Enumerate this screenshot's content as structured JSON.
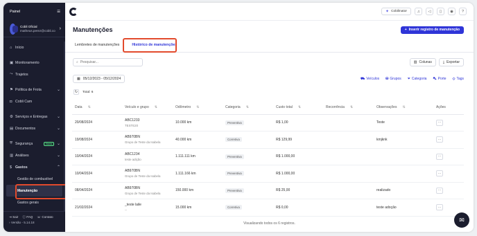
{
  "sidebar": {
    "title": "Painel",
    "user_name": "Cobli Oficial",
    "user_email": "matheus.perez@cobli.co",
    "items": [
      {
        "label": "Início",
        "icon": "home-icon",
        "arrow": ""
      },
      {
        "label": "Monitoramento",
        "icon": "monitor-icon",
        "arrow": ""
      },
      {
        "label": "Trajetos",
        "icon": "route-icon",
        "arrow": ""
      },
      {
        "label": "Política de Frota",
        "icon": "policy-icon",
        "arrow": "⌄"
      },
      {
        "label": "Cobli Cam",
        "icon": "camera-icon",
        "arrow": ""
      },
      {
        "label": "Serviços e Entregas",
        "icon": "services-icon",
        "arrow": "⌄"
      },
      {
        "label": "Documentos",
        "icon": "documents-icon",
        "arrow": "⌄"
      },
      {
        "label": "Segurança",
        "icon": "security-icon",
        "arrow": "⌄",
        "badge": "Novo"
      },
      {
        "label": "Análises",
        "icon": "analytics-icon",
        "arrow": "⌄"
      },
      {
        "label": "Gastos",
        "icon": "dollar-icon",
        "arrow": "⌃"
      }
    ],
    "sub_items": [
      "Gestão de combustível",
      "Manutenção",
      "Gastos gerais"
    ],
    "footer": {
      "sair": "Sair",
      "faq": "FAQ",
      "contato": "Contato",
      "version": "Versão - 5.14.18"
    }
  },
  "topbar": {
    "cobilinator": "Cobilinator"
  },
  "header": {
    "title": "Manutenções",
    "insert_button": "Inserir registro de manutenção"
  },
  "tabs": [
    "Lembretes de manutenções",
    "Histórico de manutenções"
  ],
  "search": {
    "placeholder": "Pesquisar..."
  },
  "toolbar": {
    "columns": "Colunas",
    "export": "Exportar"
  },
  "date_range": "05/12/2023 - 05/12/2024",
  "filters": [
    "Veículos",
    "Grupos",
    "Categoria",
    "Porte",
    "Tags"
  ],
  "total": "Total: 6",
  "table": {
    "headers": [
      "Data",
      "Veículo e grupo",
      "Odômetro",
      "Categoria",
      "Custo total",
      "Recorrência",
      "Observações",
      "Ações"
    ],
    "rows": [
      {
        "date": "20/08/2024",
        "vehicle": "ABC1233",
        "group": "TESTE20",
        "odometer": "10.000 km",
        "category": "Preventiva",
        "cost": "R$ 1,00",
        "recurrence": "",
        "notes": "Teste"
      },
      {
        "date": "19/08/2024",
        "vehicle": "AB970BN",
        "group": "Grupo de Teste da Isabela",
        "odometer": "40.000 km",
        "category": "Corretiva",
        "cost": "R$ 129,99",
        "recurrence": "",
        "notes": "kmjknk"
      },
      {
        "date": "10/04/2024",
        "vehicle": "ABC1234",
        "group": "teste adição",
        "odometer": "1.111.111 km",
        "category": "Preventiva",
        "cost": "R$ 1.000,00",
        "recurrence": "",
        "notes": ""
      },
      {
        "date": "10/04/2024",
        "vehicle": "AB970BN",
        "group": "Grupo de Teste da Isabela",
        "odometer": "1.111.166 km",
        "category": "Preventiva",
        "cost": "R$ 1.000,00",
        "recurrence": "",
        "notes": ""
      },
      {
        "date": "08/04/2024",
        "vehicle": "AB970BN",
        "group": "Grupo de Teste da Isabela",
        "odometer": "150.000 km",
        "category": "Preventiva",
        "cost": "R$ 25,00",
        "recurrence": "",
        "notes": "realizado"
      },
      {
        "date": "21/02/2024",
        "vehicle": "_teste laile",
        "group": "--",
        "odometer": "15.000 km",
        "category": "Corretiva",
        "cost": "R$ 0,00",
        "recurrence": "",
        "notes": "teste adoção"
      }
    ]
  },
  "footer_text": "Visualizando todos os 6 registros."
}
